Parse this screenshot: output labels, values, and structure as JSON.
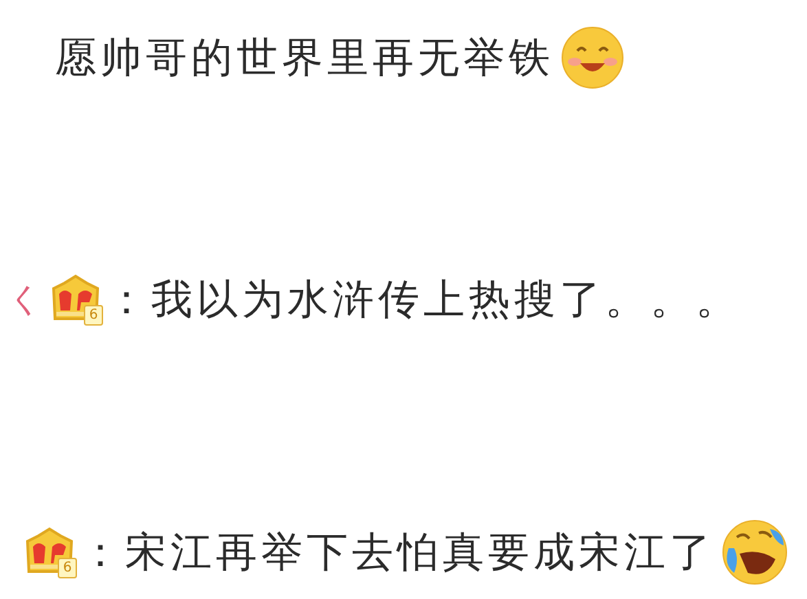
{
  "post": {
    "text": "愿帅哥的世界里再无举铁",
    "emoji": {
      "kind": "smile"
    }
  },
  "replies": [
    {
      "name": "く",
      "badge": "6",
      "text": "：我以为水浒传上热搜了。。。"
    },
    {
      "badge": "6",
      "text": "：宋江再举下去怕真要成宋江了",
      "emoji": {
        "kind": "laugh-cry"
      }
    }
  ]
}
